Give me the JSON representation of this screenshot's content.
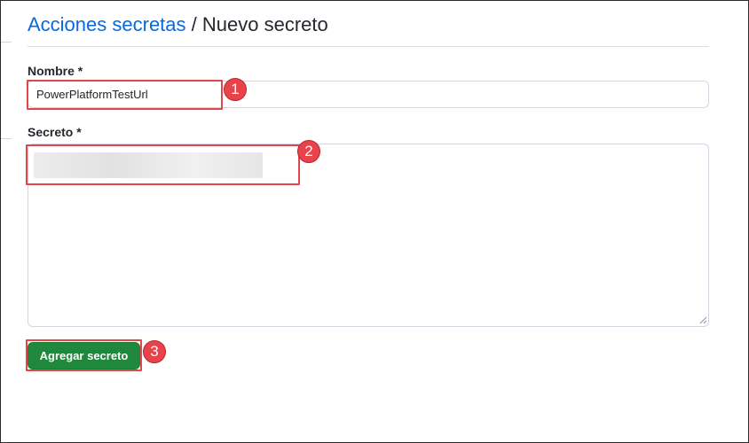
{
  "breadcrumb": {
    "link": "Acciones secretas",
    "separator": "/",
    "current": "Nuevo secreto"
  },
  "form": {
    "name_label": "Nombre *",
    "name_value": "PowerPlatformTestUrl",
    "secret_label": "Secreto *",
    "secret_value": "",
    "submit_label": "Agregar secreto"
  },
  "callouts": [
    "1",
    "2",
    "3"
  ],
  "colors": {
    "link": "#0969da",
    "primary_button": "#1f883d",
    "callout": "#e8434a"
  }
}
